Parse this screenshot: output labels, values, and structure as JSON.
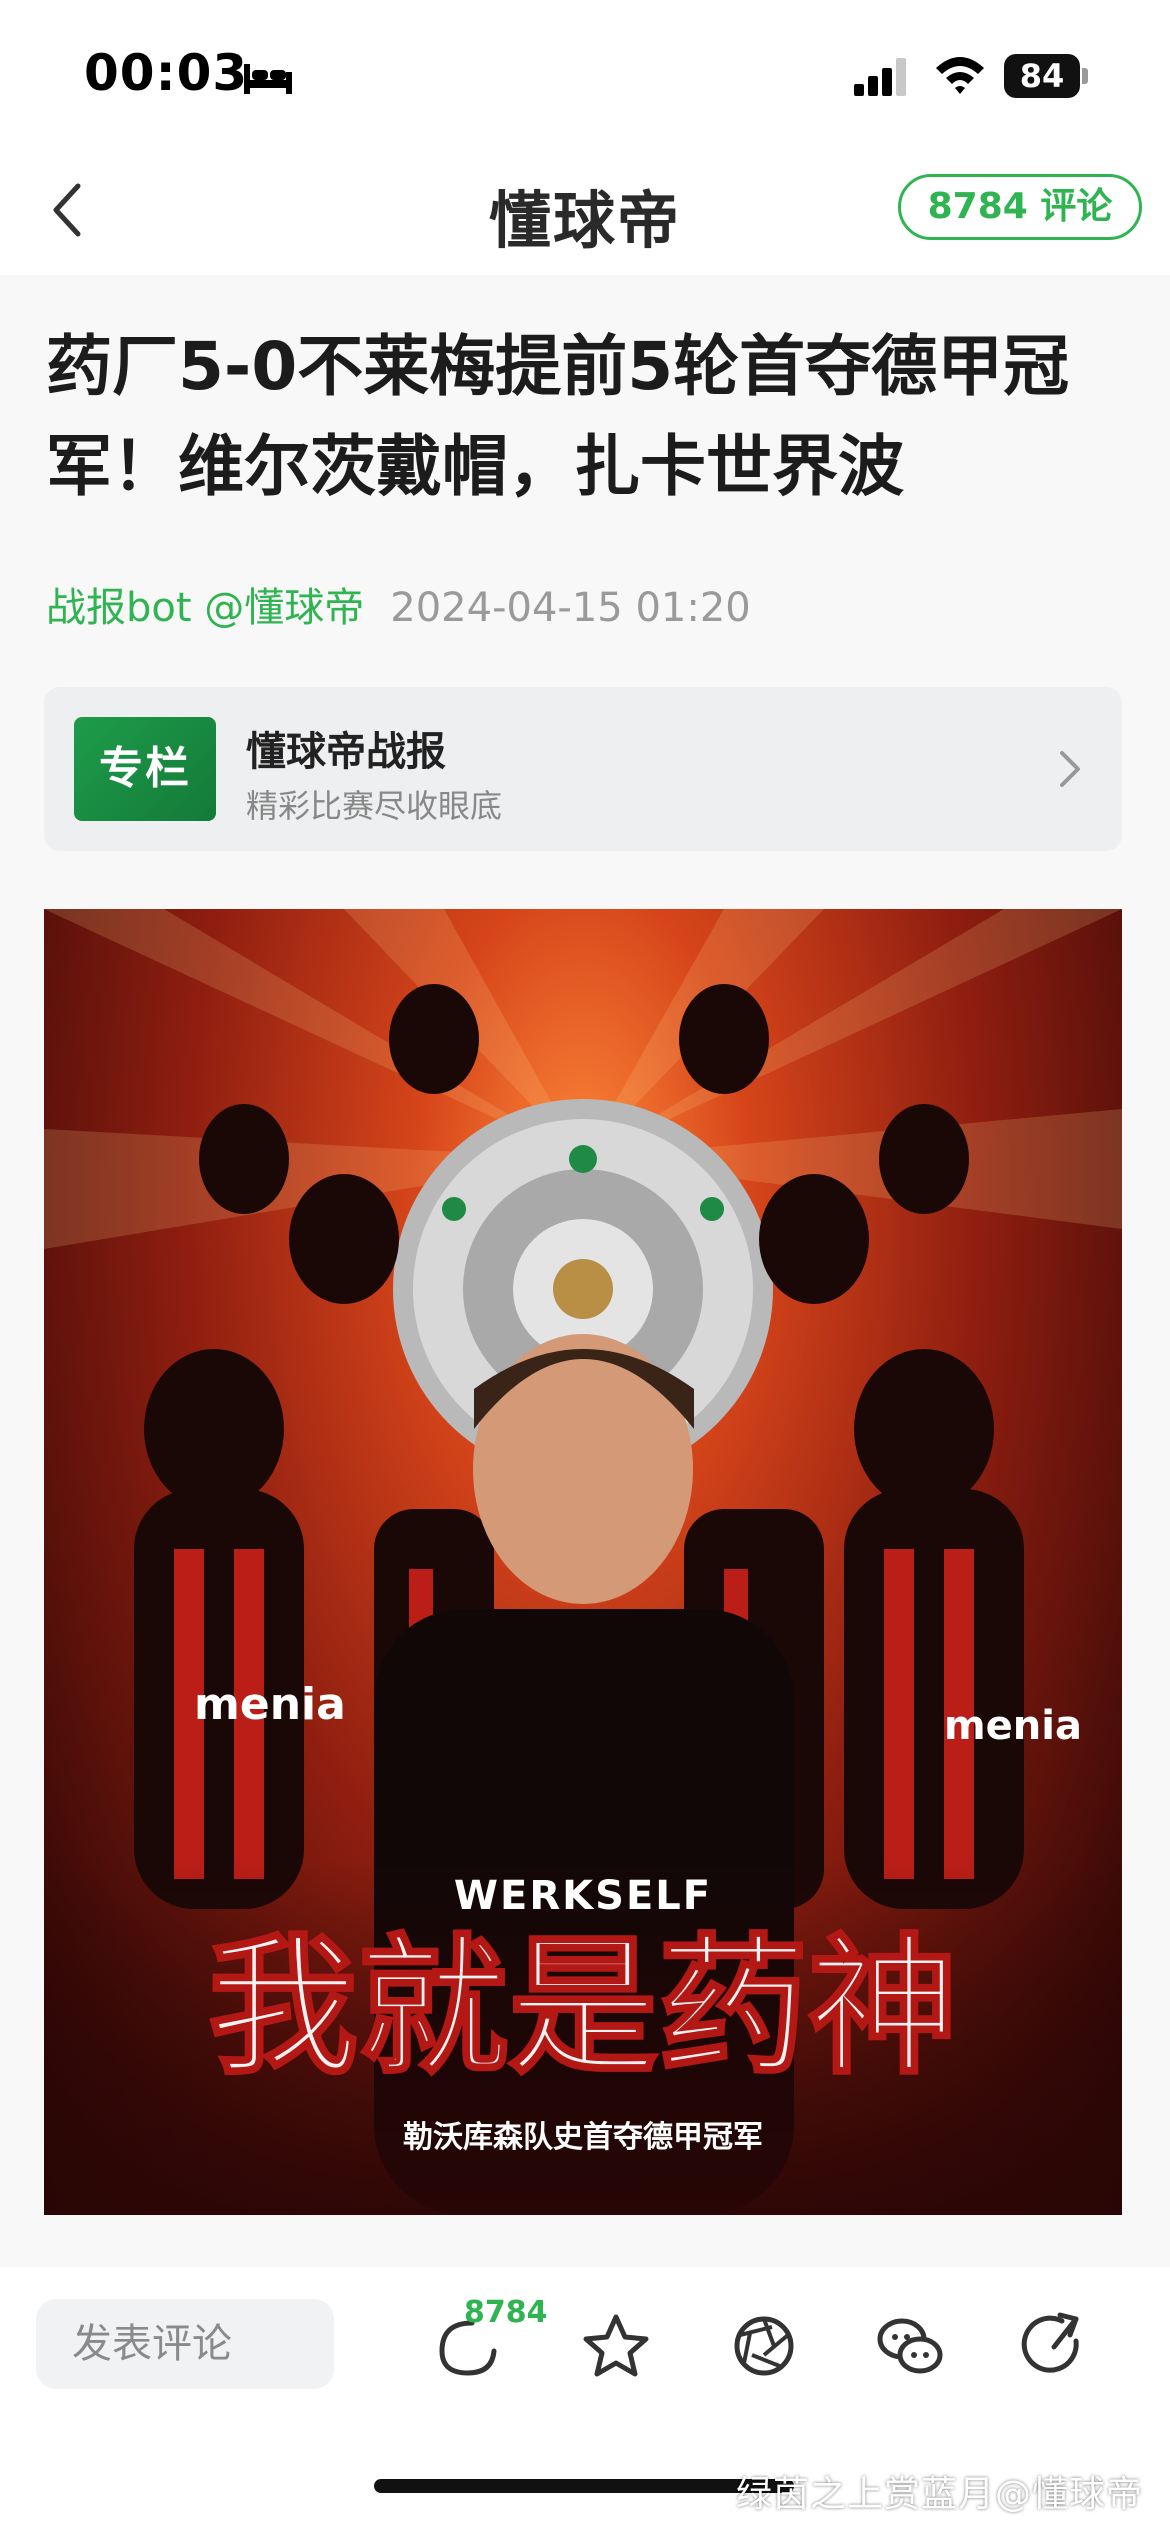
{
  "status_bar": {
    "time": "00:03",
    "battery": "84"
  },
  "nav": {
    "title": "懂球帝",
    "comments_button": "8784 评论"
  },
  "article": {
    "title": "药厂5-0不莱梅提前5轮首夺德甲冠军！维尔茨戴帽，扎卡世界波",
    "author": "战报bot @懂球帝",
    "date": "2024-04-15 01:20"
  },
  "column": {
    "badge": "专栏",
    "name": "懂球帝战报",
    "description": "精彩比赛尽收眼底"
  },
  "poster": {
    "brand": "WERKSELF",
    "headline": "我就是药神",
    "subtitle": "勒沃库森队史首夺德甲冠军",
    "sponsor_left": "menia",
    "sponsor_right": "menia"
  },
  "bottom_bar": {
    "input_placeholder": "发表评论",
    "comment_count": "8784"
  },
  "watermark": "绿茵之上赏蓝月@懂球帝",
  "colors": {
    "accent": "#2fb451",
    "poster_red": "#d6451a"
  }
}
